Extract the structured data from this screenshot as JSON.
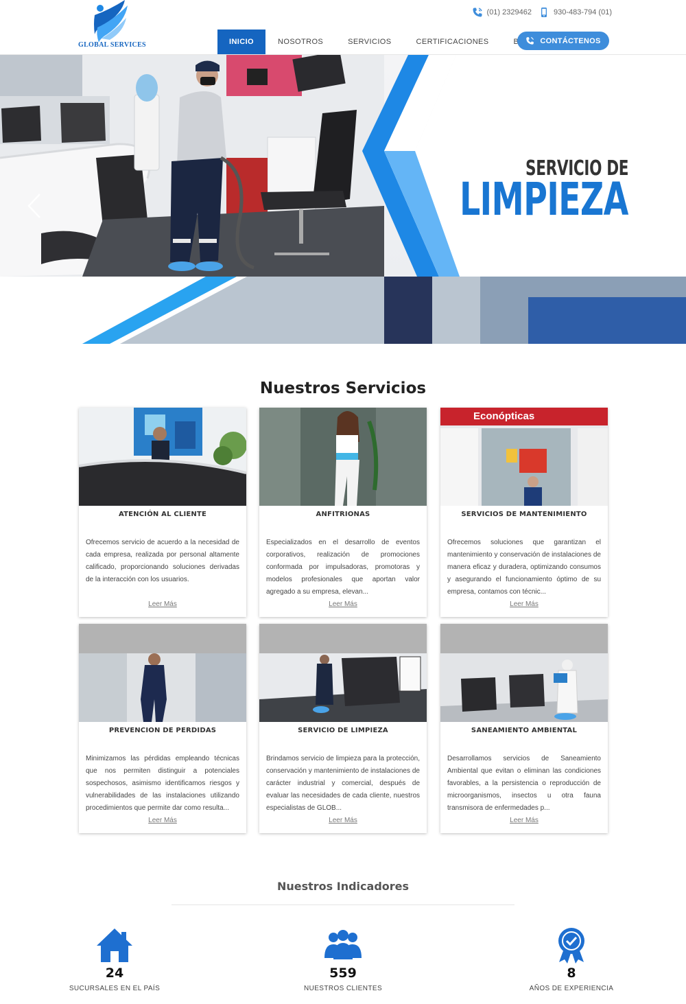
{
  "brand": {
    "name": "GLOBAL SERVICES"
  },
  "contact": {
    "phone": "(01) 2329462",
    "mobile": "930-483-794 (01)"
  },
  "nav": {
    "items": [
      {
        "label": "INICIO",
        "active": true
      },
      {
        "label": "NOSOTROS",
        "active": false
      },
      {
        "label": "SERVICIOS",
        "active": false
      },
      {
        "label": "CERTIFICACIONES",
        "active": false
      },
      {
        "label": "BLOG",
        "active": false
      }
    ],
    "cta_label": "CONTÁCTENOS"
  },
  "hero": {
    "line1": "SERVICIO DE",
    "line2": "LIMPIEZA"
  },
  "services": {
    "title": "Nuestros Servicios",
    "read_more": "Leer Más",
    "cards": [
      {
        "title": "ATENCIÓN AL CLIENTE",
        "text": "Ofrecemos servicio de acuerdo a la necesidad de cada empresa, realizada por personal altamente calificado, proporcionando soluciones derivadas de la interacción con los usuarios."
      },
      {
        "title": "ANFITRIONAS",
        "text": "Especializados en el desarrollo de eventos corporativos, realización de promociones conformada por impulsadoras, promotoras y modelos profesionales que aportan valor agregado a su empresa, elevan..."
      },
      {
        "title": "SERVICIOS DE MANTENIMIENTO",
        "text": "Ofrecemos soluciones que garantizan el mantenimiento y conservación de instalaciones de manera eficaz y duradera, optimizando consumos y asegurando el funcionamiento óptimo de su empresa, contamos con técnic...",
        "sign_text": "Econópticas"
      },
      {
        "title": "PREVENCION DE PERDIDAS",
        "text": "Minimizamos las pérdidas empleando técnicas que nos permiten distinguir a potenciales sospechosos, asimismo identificamos riesgos y vulnerabilidades de las instalaciones utilizando procedimientos que permite dar como resulta..."
      },
      {
        "title": "SERVICIO DE LIMPIEZA",
        "text": "Brindamos servicio de limpieza para la protección, conservación y mantenimiento de instalaciones de carácter industrial y comercial, después de evaluar las necesidades de cada cliente, nuestros especialistas de GLOB..."
      },
      {
        "title": "SANEAMIENTO AMBIENTAL",
        "text": "Desarrollamos servicios de Saneamiento Ambiental que evitan o eliminan las condiciones favorables, a la persistencia o reproducción de microorganismos, insectos u otra fauna transmisora de enfermedades p..."
      }
    ]
  },
  "indicators": {
    "title": "Nuestros Indicadores",
    "items": [
      {
        "value": "24",
        "label": "SUCURSALES EN EL PAÍS",
        "icon": "house-icon"
      },
      {
        "value": "559",
        "label": "NUESTROS CLIENTES",
        "icon": "users-icon"
      },
      {
        "value": "8",
        "label": "AÑOS DE EXPERIENCIA",
        "icon": "award-badge-icon"
      }
    ]
  },
  "colors": {
    "primary": "#1565c0",
    "accent": "#3e8ddb",
    "hero_blue": "#1976d2",
    "stripe_blue": "#29a3f0"
  }
}
